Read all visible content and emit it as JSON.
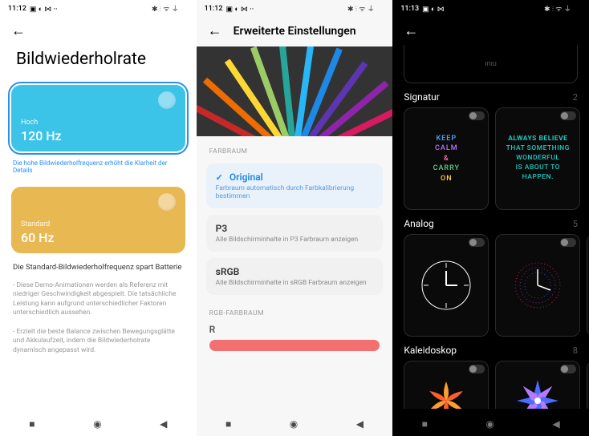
{
  "phone1": {
    "statusTime": "11:12",
    "statusExtra": "▣ ◐ ⋈ ··",
    "title": "Bildwiederholrate",
    "cards": [
      {
        "label": "Hoch",
        "value": "120 Hz",
        "hint": "Die hohe Bildwiederholfrequenz erhöht die Klarheit der Details",
        "color": "blue",
        "selected": true
      },
      {
        "label": "Standard",
        "value": "60 Hz",
        "hint": "Die Standard-Bildwiederholfrequenz spart Batterie",
        "color": "gold",
        "selected": false
      }
    ],
    "note1": "- Diese Demo-Animationen werden als Referenz mit niedriger Geschwindigkeit abgespielt. Die tatsächliche Leistung kann aufgrund unterschiedlicher Faktoren unterschiedlich aussehen.",
    "note2": "- Erzielt die beste Balance zwischen Bewegungsglätte und Akkulaufzeit, indem die Bildwiederholrate dynamisch angepasst wird."
  },
  "phone2": {
    "statusTime": "11:12",
    "statusExtra": "▣ ◐ ⋈ ··",
    "title": "Erweiterte Einstellungen",
    "sectionColor": "FARBRAUM",
    "options": [
      {
        "title": "Original",
        "sub": "Farbraum automatisch durch Farbkalibrierung bestimmen",
        "active": true
      },
      {
        "title": "P3",
        "sub": "Alle Bildschirminhalte in P3 Farbraum anzeigen",
        "active": false
      },
      {
        "title": "sRGB",
        "sub": "Alle Bildschirminhalte in sRGB Farbraum anzeigen",
        "active": false
      }
    ],
    "sectionRGB": "RGB-FARBRAUM",
    "rLabel": "R"
  },
  "phone3": {
    "statusTime": "11:13",
    "statusExtra": "▣ ◐ ⋈",
    "topPlaceholder": "ınıu",
    "sections": [
      {
        "name": "Signatur",
        "count": "2"
      },
      {
        "name": "Analog",
        "count": "5"
      },
      {
        "name": "Kaleidoskop",
        "count": "8"
      }
    ],
    "sigA": {
      "l1": "KEEP",
      "l2": "CALM",
      "l3": "&",
      "l4": "CARRY",
      "l5": "ON"
    },
    "sigB": {
      "line1": "ALWAYS BELIEVE",
      "line2": "THAT SOMETHING",
      "line3": "WONDERFUL",
      "line4": "IS ABOUT TO",
      "line5": "HAPPEN."
    }
  },
  "icons": {
    "back": "←"
  }
}
